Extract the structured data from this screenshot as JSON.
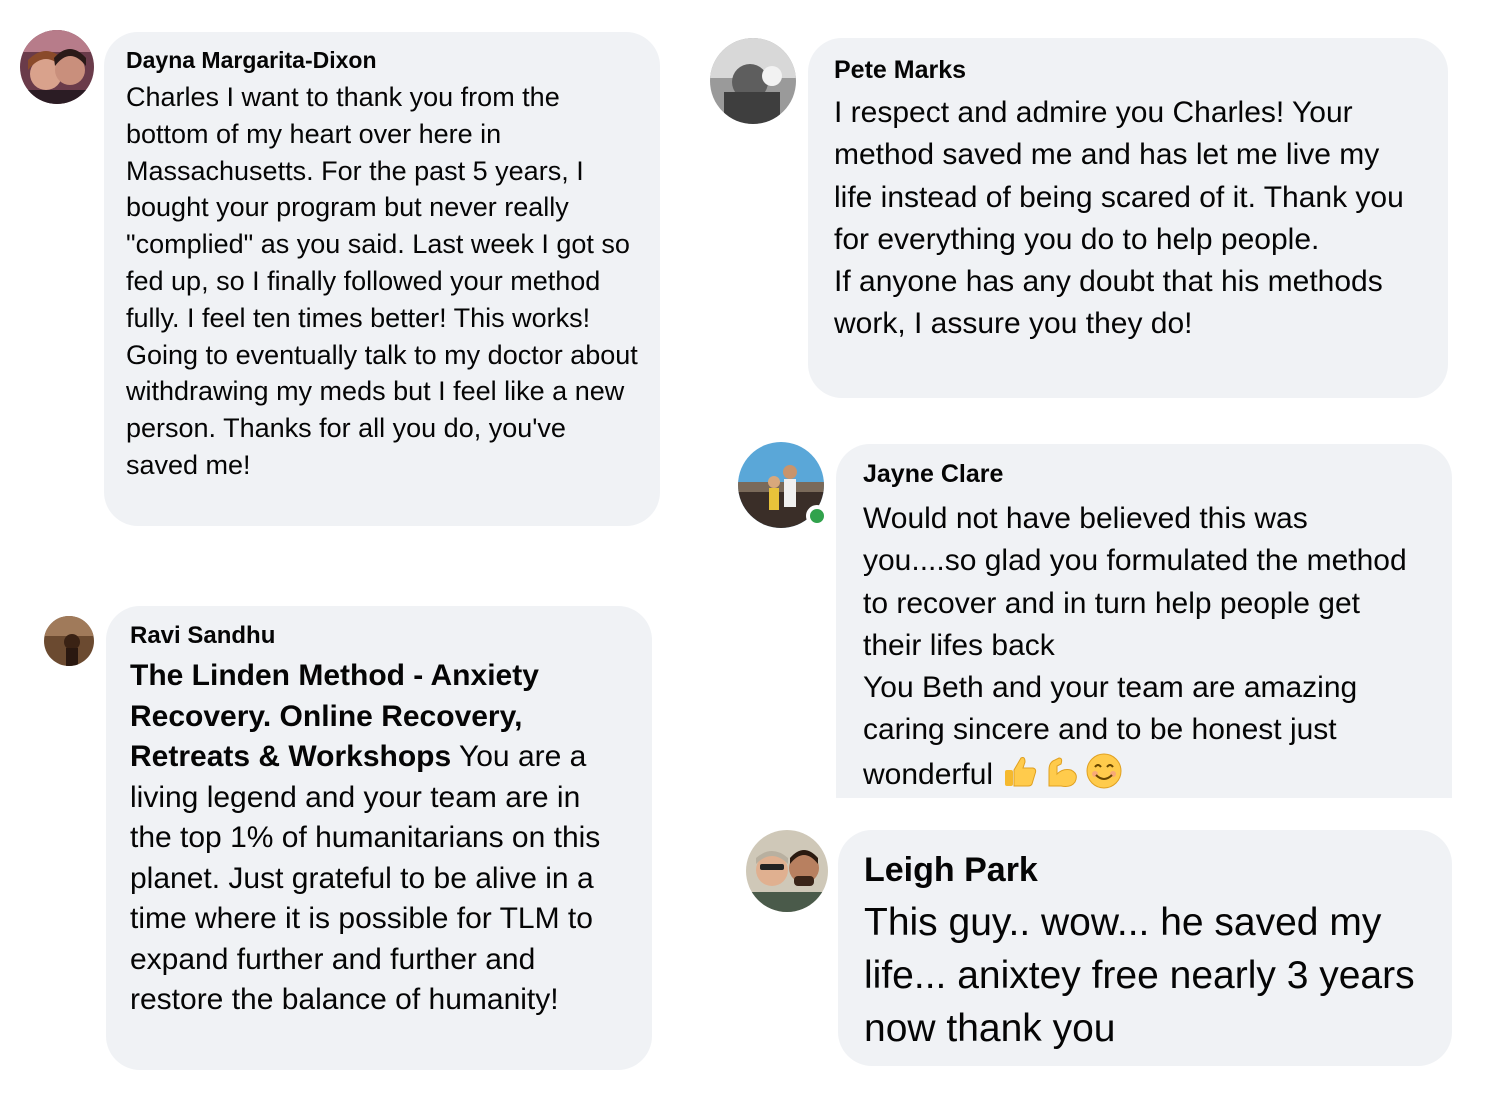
{
  "comments": [
    {
      "author": "Dayna Margarita-Dixon",
      "text": "Charles I want to thank you from the bottom of my heart over here in Massachusetts. For the past 5 years, I bought your program but never really \"complied\" as you said. Last week I got so fed up, so I finally followed your method fully. I feel ten times better! This works! Going to eventually talk to my doctor about withdrawing my meds but I feel like a new person. Thanks for all you do, you've saved me!"
    },
    {
      "author": "Pete Marks",
      "text": "I respect and admire you Charles! Your method saved me and has let me live my life instead of being scared of it. Thank you for everything you do to help people.\nIf anyone has any doubt that his methods work, I assure you they do!"
    },
    {
      "author": "Jayne Clare",
      "text": "Would not have believed this was you....so glad you formulated the method to recover and in turn help people get their lifes back\nYou Beth and your team are amazing caring sincere and to be honest just wonderful",
      "emojis": [
        "thumbs-up-emoji",
        "flexed-biceps-emoji",
        "smiling-face-emoji"
      ],
      "online": true
    },
    {
      "author": "Ravi Sandhu",
      "link_title": "The Linden Method - Anxiety Recovery. Online Recovery, Retreats & Workshops",
      "text": " You are a living legend and your team are in the top 1% of humanitarians on this planet. Just grateful to be alive in a time where it is possible for TLM to expand further and further and restore the balance of humanity!"
    },
    {
      "author": "Leigh Park",
      "text": "This guy.. wow... he saved my life... anixtey free nearly 3 years now thank you"
    }
  ],
  "colors": {
    "bubble": "#f0f2f5",
    "text": "#050505",
    "online": "#31a24c"
  }
}
